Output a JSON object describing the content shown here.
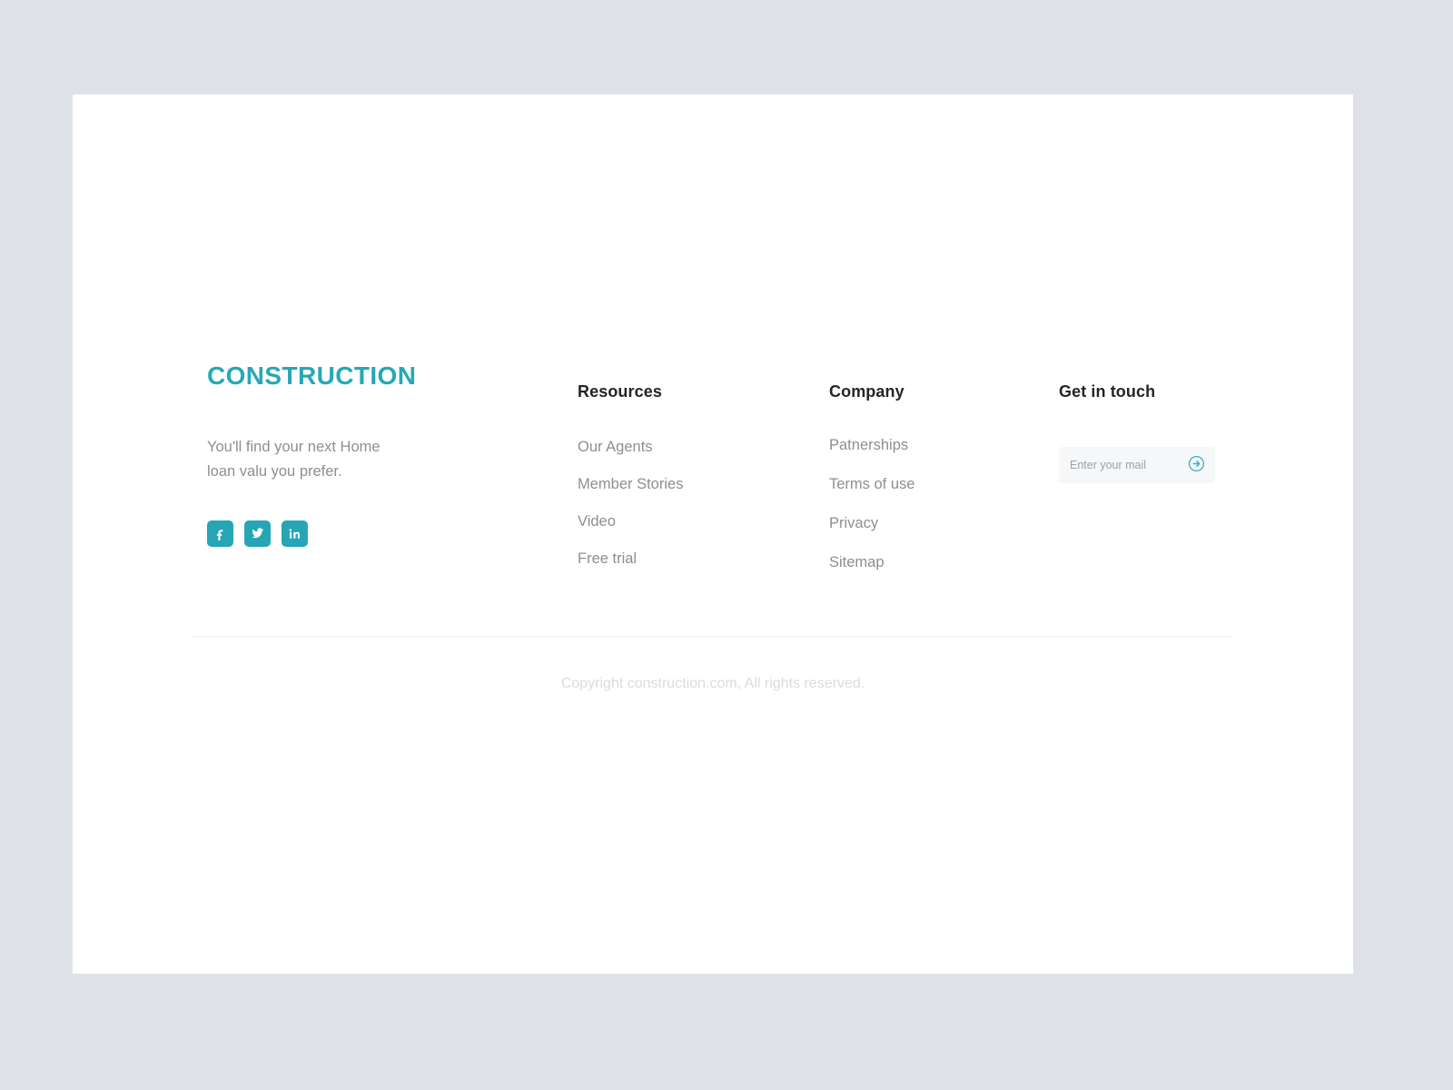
{
  "theme": {
    "page_background": "#dee1e8",
    "card_background": "#ffffff",
    "accent": "#27a8b7",
    "social_button": "#26a6b5",
    "heading_text": "#232527",
    "body_text": "#8b8f94",
    "copyright_text": "#d9dcdf",
    "divider": "#eef0f2",
    "input_background": "#f6f7f8"
  },
  "footer": {
    "brand": {
      "logo_text": "CONSTRUCTION",
      "tagline_line_1": "You'll find your next Home",
      "tagline_line_2": "loan valu you prefer.",
      "social": [
        {
          "name": "facebook",
          "icon": "facebook-icon",
          "label": "Facebook"
        },
        {
          "name": "twitter",
          "icon": "twitter-icon",
          "label": "Twitter"
        },
        {
          "name": "linkedin",
          "icon": "linkedin-icon",
          "label": "LinkedIn"
        }
      ]
    },
    "columns": [
      {
        "key": "resources",
        "title": "Resources",
        "links": [
          "Our Agents",
          "Member Stories",
          "Video",
          "Free trial"
        ]
      },
      {
        "key": "company",
        "title": "Company",
        "links": [
          "Patnerships",
          "Terms of use",
          "Privacy",
          "Sitemap"
        ]
      }
    ],
    "contact": {
      "title": "Get in touch",
      "email_placeholder": "Enter your mail",
      "email_value": "",
      "submit_icon": "arrow-right-circle-icon"
    },
    "copyright": "Copyright construction.com, All rights reserved."
  }
}
